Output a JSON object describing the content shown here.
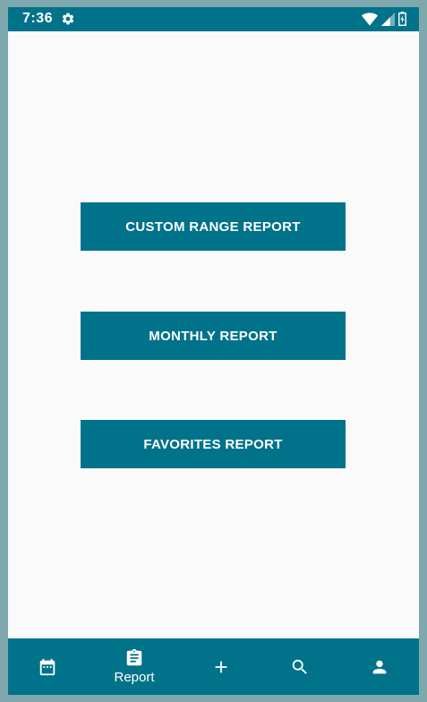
{
  "status_bar": {
    "time": "7:36",
    "icons": [
      "settings-gear-icon",
      "wifi-icon",
      "signal-icon",
      "battery-icon"
    ]
  },
  "buttons": {
    "custom_range_report": "CUSTOM RANGE REPORT",
    "monthly_report": "MONTHLY REPORT",
    "favorites_report": "FAVORITES REPORT"
  },
  "bottom_nav": {
    "items": [
      {
        "icon": "calendar-icon",
        "label": ""
      },
      {
        "icon": "clipboard-icon",
        "label": "Report"
      },
      {
        "icon": "add-icon",
        "label": ""
      },
      {
        "icon": "search-icon",
        "label": ""
      },
      {
        "icon": "person-icon",
        "label": ""
      }
    ]
  },
  "colors": {
    "primary": "#00728a",
    "background": "#fafafa",
    "frame": "#7ea8ad",
    "on_primary": "#ffffff"
  }
}
